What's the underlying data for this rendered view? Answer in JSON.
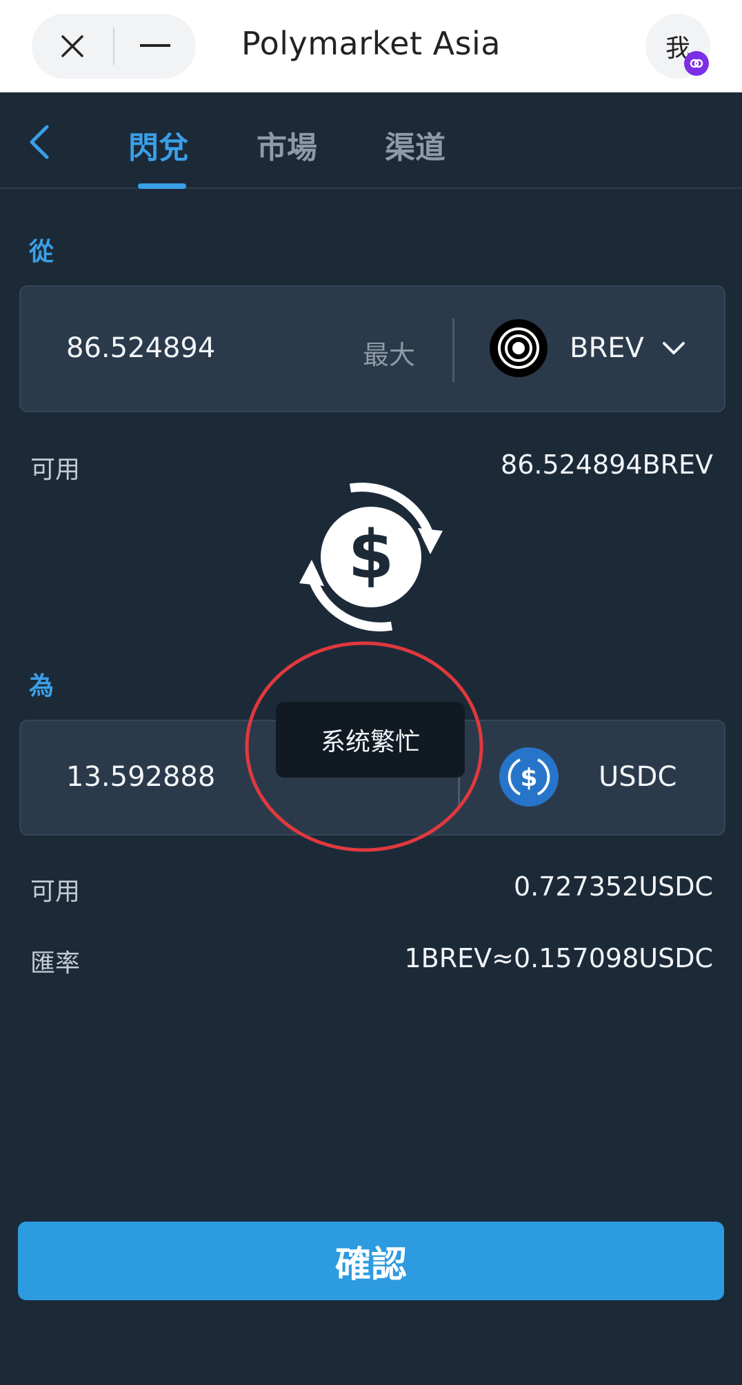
{
  "window": {
    "title": "Polymarket Asia",
    "me_label": "我"
  },
  "tabs": [
    {
      "label": "閃兌",
      "active": true
    },
    {
      "label": "市場",
      "active": false
    },
    {
      "label": "渠道",
      "active": false
    }
  ],
  "from": {
    "label": "從",
    "amount": "86.524894",
    "max_label": "最大",
    "token": "BREV",
    "available_label": "可用",
    "available_value": "86.524894BREV"
  },
  "to": {
    "label": "為",
    "amount": "13.592888",
    "token": "USDC",
    "available_label": "可用",
    "available_value": "0.727352USDC"
  },
  "rate": {
    "label": "匯率",
    "value": "1BREV≈0.157098USDC"
  },
  "toast": "系统繁忙",
  "confirm_label": "確認",
  "colors": {
    "accent": "#3aa0e8",
    "background": "#1c2a38",
    "annotation_circle": "#e0393e"
  }
}
